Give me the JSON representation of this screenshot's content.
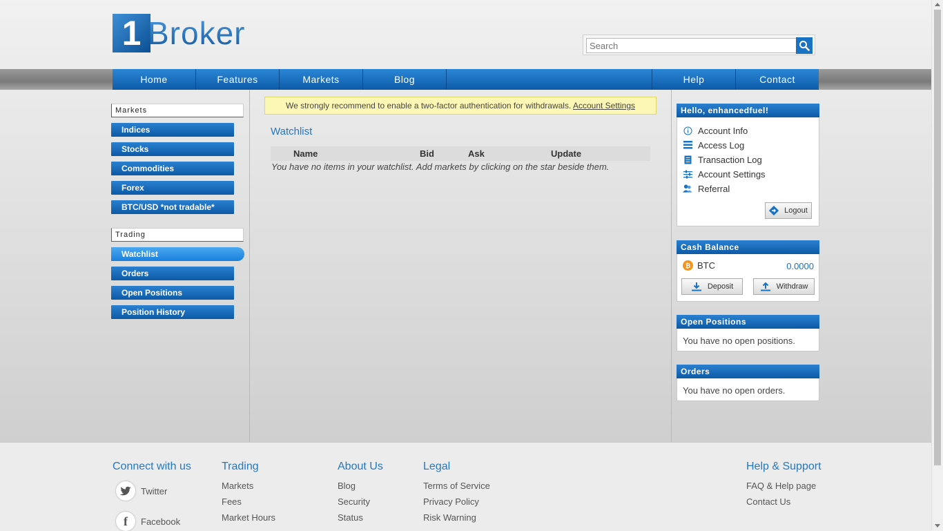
{
  "brand": {
    "logo_number": "1",
    "logo_text": "Broker"
  },
  "search": {
    "placeholder": "Search"
  },
  "nav": {
    "left": [
      "Home",
      "Features",
      "Markets",
      "Blog"
    ],
    "right": [
      "Help",
      "Contact"
    ]
  },
  "sidebar": {
    "markets_heading": "Markets",
    "markets": [
      "Indices",
      "Stocks",
      "Commodities",
      "Forex",
      "BTC/USD *not tradable*"
    ],
    "trading_heading": "Trading",
    "trading": [
      "Watchlist",
      "Orders",
      "Open Positions",
      "Position History"
    ],
    "active_item": "Watchlist"
  },
  "notice": {
    "text": "We strongly recommend to enable a two-factor authentication for withdrawals.",
    "link": "Account Settings"
  },
  "watchlist": {
    "title": "Watchlist",
    "columns": [
      "Name",
      "Bid",
      "Ask",
      "Update"
    ],
    "empty_message": "You have no items in your watchlist. Add markets by clicking on the star beside them."
  },
  "account": {
    "heading": "Hello, enhancedfuel!",
    "links": [
      {
        "label": "Account Info",
        "icon": "info-icon"
      },
      {
        "label": "Access Log",
        "icon": "list-icon"
      },
      {
        "label": "Transaction Log",
        "icon": "document-icon"
      },
      {
        "label": "Account Settings",
        "icon": "sliders-icon"
      },
      {
        "label": "Referral",
        "icon": "users-icon"
      }
    ],
    "logout_label": "Logout"
  },
  "cash": {
    "heading": "Cash Balance",
    "currency": "BTC",
    "amount": "0.0000",
    "deposit_label": "Deposit",
    "withdraw_label": "Withdraw"
  },
  "open_positions": {
    "heading": "Open Positions",
    "message": "You have no open positions."
  },
  "orders": {
    "heading": "Orders",
    "message": "You have no open orders."
  },
  "footer": {
    "connect": {
      "heading": "Connect with us",
      "twitter": "Twitter",
      "facebook": "Facebook"
    },
    "trading": {
      "heading": "Trading",
      "links": [
        "Markets",
        "Fees",
        "Market Hours"
      ]
    },
    "about": {
      "heading": "About Us",
      "links": [
        "Blog",
        "Security",
        "Status"
      ]
    },
    "legal": {
      "heading": "Legal",
      "links": [
        "Terms of Service",
        "Privacy Policy",
        "Risk Warning"
      ]
    },
    "help": {
      "heading": "Help & Support",
      "links": [
        "FAQ & Help page",
        "Contact Us"
      ]
    }
  },
  "colors": {
    "brand_blue": "#1a72c2",
    "accent_link": "#2478c0",
    "notice_bg": "#fdf7b6",
    "btc_orange": "#f2931a"
  }
}
